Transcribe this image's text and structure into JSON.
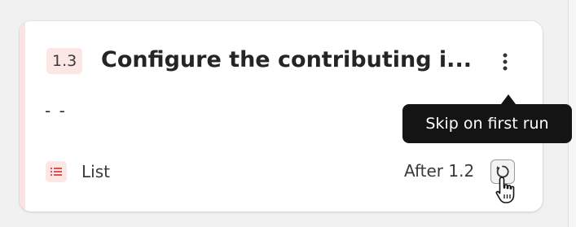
{
  "card": {
    "step_number": "1.3",
    "title": "Configure the contributing i...",
    "description": "- -",
    "type_label": "List",
    "dependency_label": "After 1.2",
    "more_icon": "vertical-ellipsis-icon",
    "type_icon": "list-icon",
    "skip_icon": "rotate-arrow-icon"
  },
  "tooltip": {
    "text": "Skip on first run"
  },
  "colors": {
    "accent": "#fbe3e1",
    "badge_bg": "#fde7e5",
    "tooltip_bg": "#141414"
  }
}
